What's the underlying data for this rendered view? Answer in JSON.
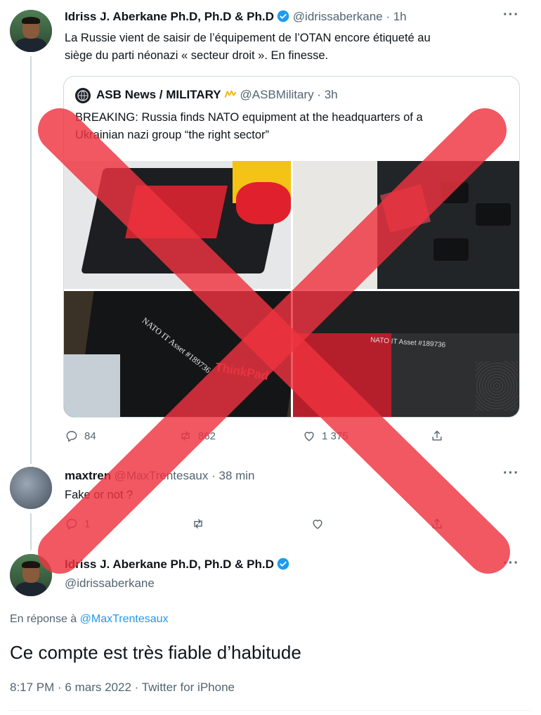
{
  "tweet1": {
    "name": "Idriss J. Aberkane Ph.D, Ph.D & Ph.D",
    "handle_time": "@idrissaberkane · 1h",
    "text_line1": "La Russie vient de saisir de l’équipement de l’OTAN encore étiqueté au",
    "text_line2": "siège du parti néonazi « secteur droit ». En finesse.",
    "more": "···"
  },
  "quote": {
    "name": "ASB News / MILITARY",
    "handle_time": "@ASBMilitary · 3h",
    "text_line1": "BREAKING: Russia finds NATO equipment at the headquarters of a",
    "text_line2": "Ukrainian nazi group “the right sector”",
    "photo_label_1": "NATO IT Asset #189736",
    "photo_label_2": "ThinkPad",
    "photo_label_3": "NATO IT Asset #189736"
  },
  "tweet1_actions": {
    "replies": "84",
    "retweets": "862",
    "likes": "1 375"
  },
  "tweet2": {
    "name": "maxtren",
    "handle_time": "@MaxTrentesaux · 38 min",
    "text": "Fake or not ?",
    "more": "···",
    "replies": "1"
  },
  "tweet3": {
    "name": "Idriss J. Aberkane Ph.D, Ph.D & Ph.D",
    "handle": "@idrissaberkane",
    "more": "···",
    "reply_prefix": "En réponse à ",
    "reply_to": "@MaxTrentesaux",
    "text": "Ce compte est très fiable d’habitude",
    "meta": "8:17 PM · 6 mars 2022 · Twitter for iPhone"
  },
  "colors": {
    "verified": "#1d9bf0",
    "link": "#1d9bf0",
    "cross": "#ee3340"
  }
}
